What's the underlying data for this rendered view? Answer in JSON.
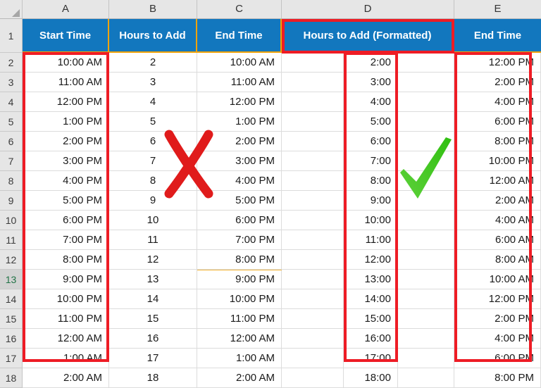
{
  "app": {
    "type": "spreadsheet",
    "accent_header_bg": "#1277be",
    "accent_header_text": "#ffffff",
    "annotation_red": "#ee1c25",
    "annotation_green": "#3dc81e",
    "separator_orange": "#f0a30a",
    "selected_row_color": "#217346"
  },
  "grid": {
    "column_letters": [
      "A",
      "B",
      "C",
      "D",
      "E"
    ],
    "row_numbers": [
      "1",
      "2",
      "3",
      "4",
      "5",
      "6",
      "7",
      "8",
      "9",
      "10",
      "11",
      "12",
      "13",
      "14",
      "15",
      "16",
      "17",
      "18"
    ],
    "selected_row": "13"
  },
  "headers": {
    "a": "Start Time",
    "b": "Hours to Add",
    "c": "End Time",
    "d": "Hours to Add (Formatted)",
    "e": "End Time"
  },
  "rows": [
    {
      "r": "2",
      "a": "10:00 AM",
      "b": "2",
      "c": "10:00 AM",
      "d": "2:00",
      "e": "12:00 PM"
    },
    {
      "r": "3",
      "a": "11:00 AM",
      "b": "3",
      "c": "11:00 AM",
      "d": "3:00",
      "e": "2:00 PM"
    },
    {
      "r": "4",
      "a": "12:00 PM",
      "b": "4",
      "c": "12:00 PM",
      "d": "4:00",
      "e": "4:00 PM"
    },
    {
      "r": "5",
      "a": "1:00 PM",
      "b": "5",
      "c": "1:00 PM",
      "d": "5:00",
      "e": "6:00 PM"
    },
    {
      "r": "6",
      "a": "2:00 PM",
      "b": "6",
      "c": "2:00 PM",
      "d": "6:00",
      "e": "8:00 PM"
    },
    {
      "r": "7",
      "a": "3:00 PM",
      "b": "7",
      "c": "3:00 PM",
      "d": "7:00",
      "e": "10:00 PM"
    },
    {
      "r": "8",
      "a": "4:00 PM",
      "b": "8",
      "c": "4:00 PM",
      "d": "8:00",
      "e": "12:00 AM"
    },
    {
      "r": "9",
      "a": "5:00 PM",
      "b": "9",
      "c": "5:00 PM",
      "d": "9:00",
      "e": "2:00 AM"
    },
    {
      "r": "10",
      "a": "6:00 PM",
      "b": "10",
      "c": "6:00 PM",
      "d": "10:00",
      "e": "4:00 AM"
    },
    {
      "r": "11",
      "a": "7:00 PM",
      "b": "11",
      "c": "7:00 PM",
      "d": "11:00",
      "e": "6:00 AM"
    },
    {
      "r": "12",
      "a": "8:00 PM",
      "b": "12",
      "c": "8:00 PM",
      "d": "12:00",
      "e": "8:00 AM"
    },
    {
      "r": "13",
      "a": "9:00 PM",
      "b": "13",
      "c": "9:00 PM",
      "d": "13:00",
      "e": "10:00 AM"
    },
    {
      "r": "14",
      "a": "10:00 PM",
      "b": "14",
      "c": "10:00 PM",
      "d": "14:00",
      "e": "12:00 PM"
    },
    {
      "r": "15",
      "a": "11:00 PM",
      "b": "15",
      "c": "11:00 PM",
      "d": "15:00",
      "e": "2:00 PM"
    },
    {
      "r": "16",
      "a": "12:00 AM",
      "b": "16",
      "c": "12:00 AM",
      "d": "16:00",
      "e": "4:00 PM"
    },
    {
      "r": "17",
      "a": "1:00 AM",
      "b": "17",
      "c": "1:00 AM",
      "d": "17:00",
      "e": "6:00 PM"
    },
    {
      "r": "18",
      "a": "2:00 AM",
      "b": "18",
      "c": "2:00 AM",
      "d": "18:00",
      "e": "8:00 PM"
    }
  ],
  "annotations": {
    "cross_mark": "red-x-mark",
    "check_mark": "green-check-mark",
    "highlight_boxes": [
      "start-time-column-highlight",
      "hours-to-add-formatted-header-highlight",
      "hours-to-add-formatted-values-highlight",
      "end-time-formatted-column-highlight"
    ]
  }
}
